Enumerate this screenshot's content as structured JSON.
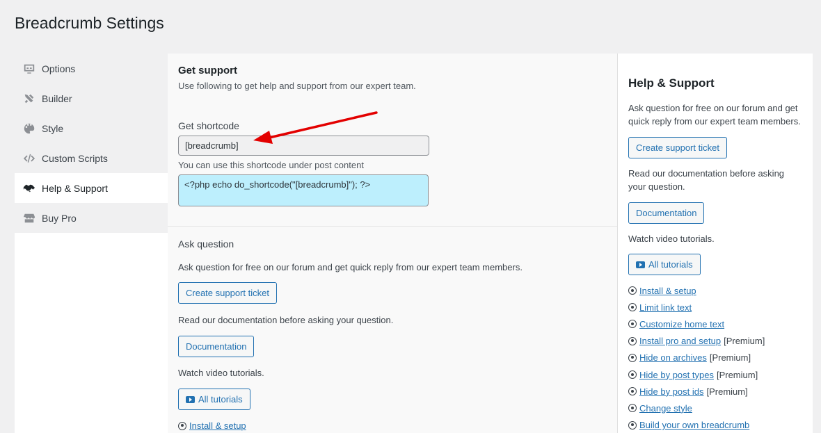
{
  "page_title": "Breadcrumb Settings",
  "nav": [
    {
      "label": "Options",
      "icon": "monitor-icon"
    },
    {
      "label": "Builder",
      "icon": "tools-icon"
    },
    {
      "label": "Style",
      "icon": "palette-icon"
    },
    {
      "label": "Custom Scripts",
      "icon": "code-icon"
    },
    {
      "label": "Help & Support",
      "icon": "handshake-icon",
      "active": true
    },
    {
      "label": "Buy Pro",
      "icon": "store-icon"
    }
  ],
  "main": {
    "heading": "Get support",
    "subtext": "Use following to get help and support from our expert team.",
    "shortcode_label": "Get shortcode",
    "shortcode_value": "[breadcrumb]",
    "shortcode_hint": "You can use this shortcode under post content",
    "php_code": "<?php echo do_shortcode(\"[breadcrumb]\"); ?>",
    "ask_label": "Ask question",
    "ask_text": "Ask question for free on our forum and get quick reply from our expert team members.",
    "ticket_button": "Create support ticket",
    "docs_text": "Read our documentation before asking your question.",
    "docs_button": "Documentation",
    "video_text": "Watch video tutorials.",
    "tutorials_button": "All tutorials",
    "link_install": "Install & setup"
  },
  "side": {
    "title": "Help & Support",
    "ask_text": "Ask question for free on our forum and get quick reply from our expert team members.",
    "ticket_button": "Create support ticket",
    "docs_text": "Read our documentation before asking your question.",
    "docs_button": "Documentation",
    "video_text": "Watch video tutorials.",
    "tutorials_button": "All tutorials",
    "links": [
      {
        "label": "Install & setup",
        "premium": ""
      },
      {
        "label": "Limit link text",
        "premium": ""
      },
      {
        "label": "Customize home text",
        "premium": ""
      },
      {
        "label": "Install pro and setup",
        "premium": "[Premium]"
      },
      {
        "label": "Hide on archives",
        "premium": "[Premium]"
      },
      {
        "label": "Hide by post types",
        "premium": "[Premium]"
      },
      {
        "label": "Hide by post ids",
        "premium": "[Premium]"
      },
      {
        "label": "Change style",
        "premium": ""
      },
      {
        "label": "Build your own breadcrumb",
        "premium": ""
      }
    ]
  },
  "colors": {
    "accent": "#2271b1",
    "arrow": "#e30000",
    "code_bg": "#bdeffd"
  }
}
